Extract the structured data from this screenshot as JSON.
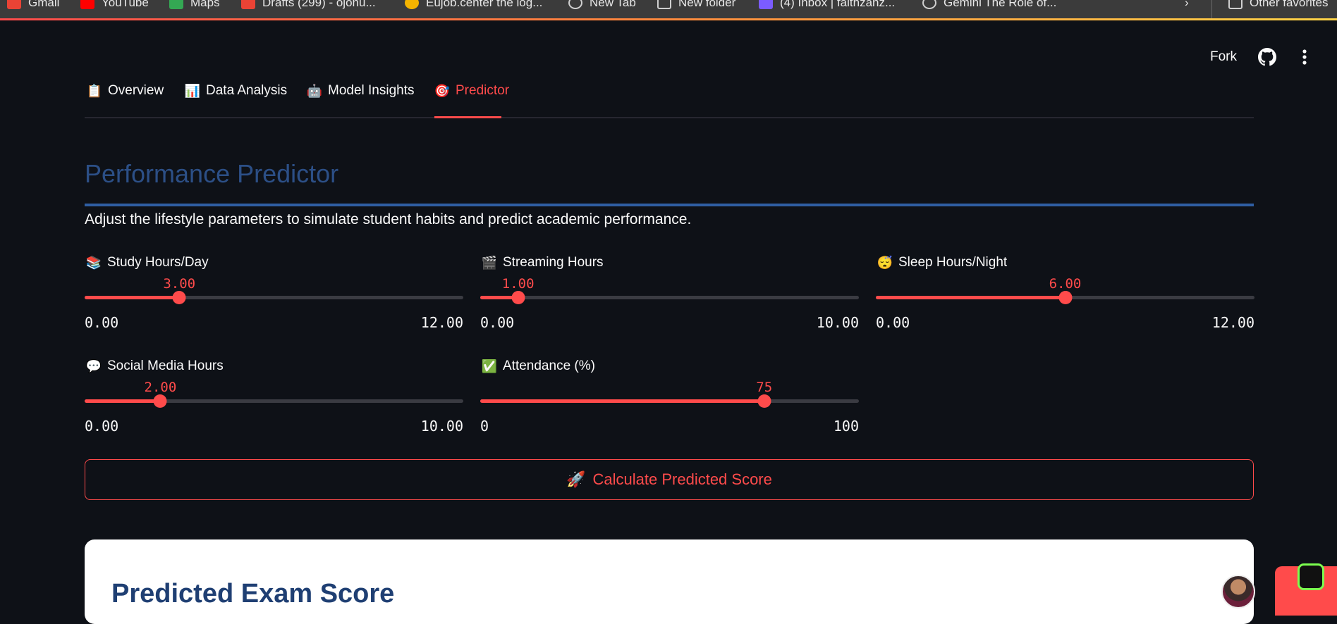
{
  "bookmarks": [
    {
      "label": "Gmail",
      "color": "#ea4335"
    },
    {
      "label": "YouTube",
      "color": "#ff0000"
    },
    {
      "label": "Maps",
      "color": "#34a853"
    },
    {
      "label": "Drafts (299) - ojonu...",
      "color": "#ea4335"
    },
    {
      "label": "Eujob.center the log...",
      "color": "#f4b400"
    },
    {
      "label": "New Tab",
      "color": "#cfcfcf"
    },
    {
      "label": "New folder",
      "color": "#cfcfcf"
    },
    {
      "label": "(4) Inbox | faithzanz...",
      "color": "#7b5cff"
    },
    {
      "label": "Gemini The Role of...",
      "color": "#cfcfcf"
    },
    {
      "label": "Other favorites",
      "color": "#cfcfcf"
    }
  ],
  "header": {
    "fork_label": "Fork",
    "github_icon": "github-icon",
    "menu_icon": "more-vertical-icon"
  },
  "tabs": [
    {
      "emoji": "📋",
      "label": "Overview"
    },
    {
      "emoji": "📊",
      "label": "Data Analysis"
    },
    {
      "emoji": "🤖",
      "label": "Model Insights"
    },
    {
      "emoji": "🎯",
      "label": "Predictor",
      "active": true
    }
  ],
  "page": {
    "title": "Performance Predictor",
    "subtitle": "Adjust the lifestyle parameters to simulate student habits and predict academic performance."
  },
  "sliders": [
    {
      "emoji": "📚",
      "label": "Study Hours/Day",
      "value": "3.00",
      "min": "0.00",
      "max": "12.00",
      "fraction": 0.25
    },
    {
      "emoji": "🎬",
      "label": "Streaming Hours",
      "value": "1.00",
      "min": "0.00",
      "max": "10.00",
      "fraction": 0.1
    },
    {
      "emoji": "😴",
      "label": "Sleep Hours/Night",
      "value": "6.00",
      "min": "0.00",
      "max": "12.00",
      "fraction": 0.5
    },
    {
      "emoji": "💬",
      "label": "Social Media Hours",
      "value": "2.00",
      "min": "0.00",
      "max": "10.00",
      "fraction": 0.2
    },
    {
      "emoji": "✅",
      "label": "Attendance (%)",
      "value": "75",
      "min": "0",
      "max": "100",
      "fraction": 0.75
    }
  ],
  "button": {
    "emoji": "🚀",
    "label": "Calculate Predicted Score"
  },
  "result": {
    "title": "Predicted Exam Score"
  },
  "colors": {
    "accent": "#ff4b4b",
    "title": "#2c4f86",
    "background": "#0e1117"
  }
}
